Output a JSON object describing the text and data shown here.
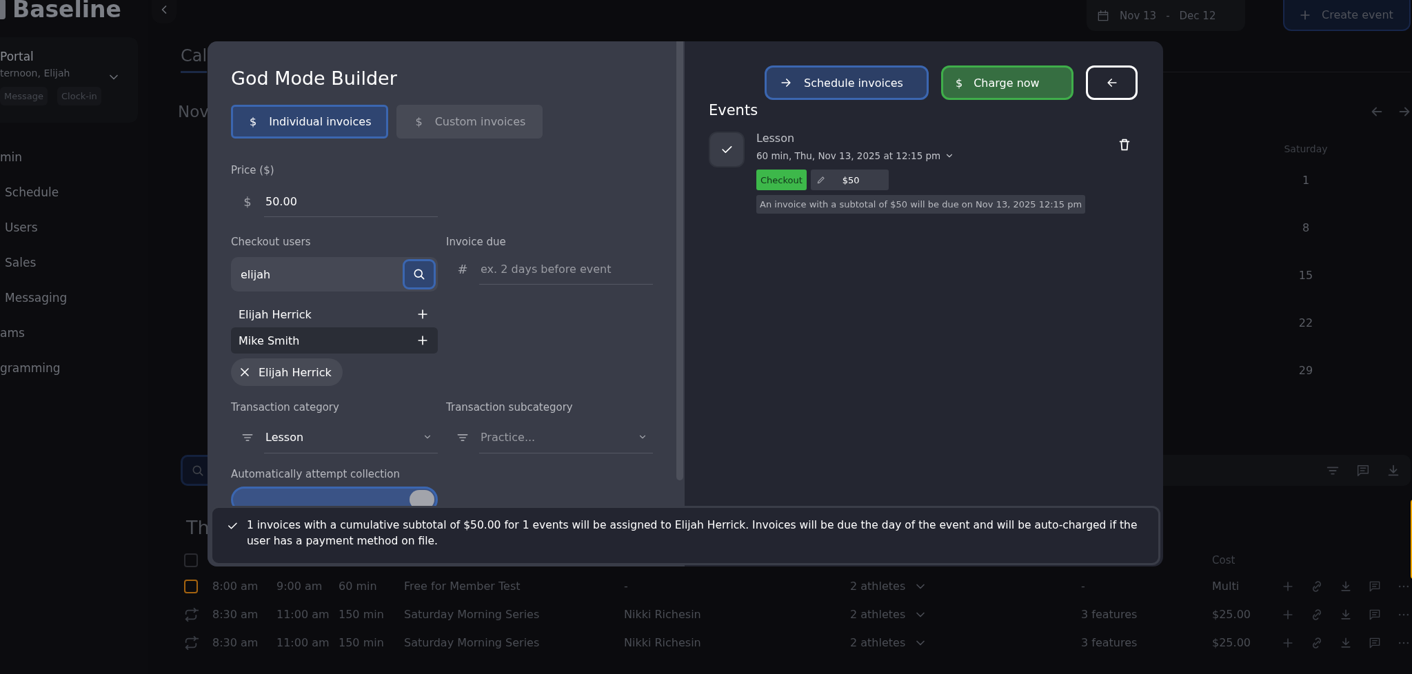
{
  "sidebar": {
    "logo": "Baseline",
    "portal": {
      "title": "Portal",
      "greeting": "ternoon, Elijah",
      "chips": [
        "Message",
        "Clock-in"
      ]
    },
    "nav": [
      {
        "label": "min",
        "kind": "section"
      },
      {
        "label": "Schedule",
        "kind": "item"
      },
      {
        "label": "Users",
        "kind": "item"
      },
      {
        "label": "Sales",
        "kind": "item"
      },
      {
        "label": "Messaging",
        "kind": "item"
      },
      {
        "label": "ams",
        "kind": "section"
      },
      {
        "label": "gramming",
        "kind": "section"
      }
    ]
  },
  "header": {
    "date_range": {
      "start": "Nov 13",
      "separator": "-",
      "end": "Dec 12"
    },
    "create_button": "Create event"
  },
  "tabs": [
    {
      "label": "Cal",
      "selected": true
    }
  ],
  "calendar": {
    "month": "Nov",
    "day_header": "Saturday",
    "days": [
      "1",
      "8",
      "15",
      "22",
      "29"
    ]
  },
  "list": {
    "heading": "Th",
    "select_all": {
      "checked": false
    },
    "cost_column": "Cost",
    "rows": [
      {
        "kind": "single",
        "start": "8:00 am",
        "end": "9:00 am",
        "duration": "60 min",
        "title": "Free for Member Test",
        "coach": "-",
        "athletes": "2 athletes",
        "features": "-",
        "cost": "Multi"
      },
      {
        "kind": "recurring",
        "start": "8:30 am",
        "end": "11:00 am",
        "duration": "150 min",
        "title": "Saturday Morning Series",
        "coach": "Nikki Richesin",
        "athletes": "2 athletes",
        "features": "3 features",
        "cost": "$25.00"
      },
      {
        "kind": "recurring",
        "start": "8:30 am",
        "end": "11:00 am",
        "duration": "150 min",
        "title": "Saturday Morning Series",
        "coach": "Nikki Richesin",
        "athletes": "2 athletes",
        "features": "3 features",
        "cost": "$25.00"
      }
    ]
  },
  "builder": {
    "title": "God Mode Builder",
    "modes": [
      {
        "icon": "$",
        "label": "Individual invoices",
        "selected": true
      },
      {
        "icon": "$",
        "label": "Custom invoices",
        "selected": false
      }
    ],
    "price": {
      "label": "Price ($)",
      "prefix": "$",
      "value": "50.00"
    },
    "checkout_users": {
      "label": "Checkout users",
      "search_value": "elijah",
      "results": [
        {
          "name": "Elijah Herrick",
          "highlighted": false
        },
        {
          "name": "Mike Smith",
          "highlighted": true
        }
      ],
      "selected_users": [
        "Elijah Herrick"
      ]
    },
    "invoice_due": {
      "label": "Invoice due",
      "prefix": "#",
      "placeholder": "ex. 2 days before event"
    },
    "category": {
      "label": "Transaction category",
      "value": "Lesson"
    },
    "subcategory": {
      "label": "Transaction subcategory",
      "placeholder": "Practice..."
    },
    "auto_collection": {
      "label": "Automatically attempt collection",
      "on": true
    }
  },
  "actions": [
    {
      "kind": "schedule",
      "label": "Schedule invoices"
    },
    {
      "kind": "charge",
      "icon": "$",
      "label": "Charge now"
    },
    {
      "kind": "back"
    }
  ],
  "events": {
    "heading": "Events",
    "items": [
      {
        "checked": true,
        "title": "Lesson",
        "when": "60 min, Thu, Nov 13, 2025 at 12:15 pm",
        "status": "Checkout",
        "amount": "$50",
        "note": "An invoice with a subtotal of $50 will be due on Nov 13, 2025 12:15 pm"
      }
    ]
  },
  "summary": "1 invoices with a cumulative subtotal of $50.00 for 1 events will be assigned to Elijah Herrick. Invoices will be due the day of the event and will be auto-charged if the user has a payment method on file."
}
